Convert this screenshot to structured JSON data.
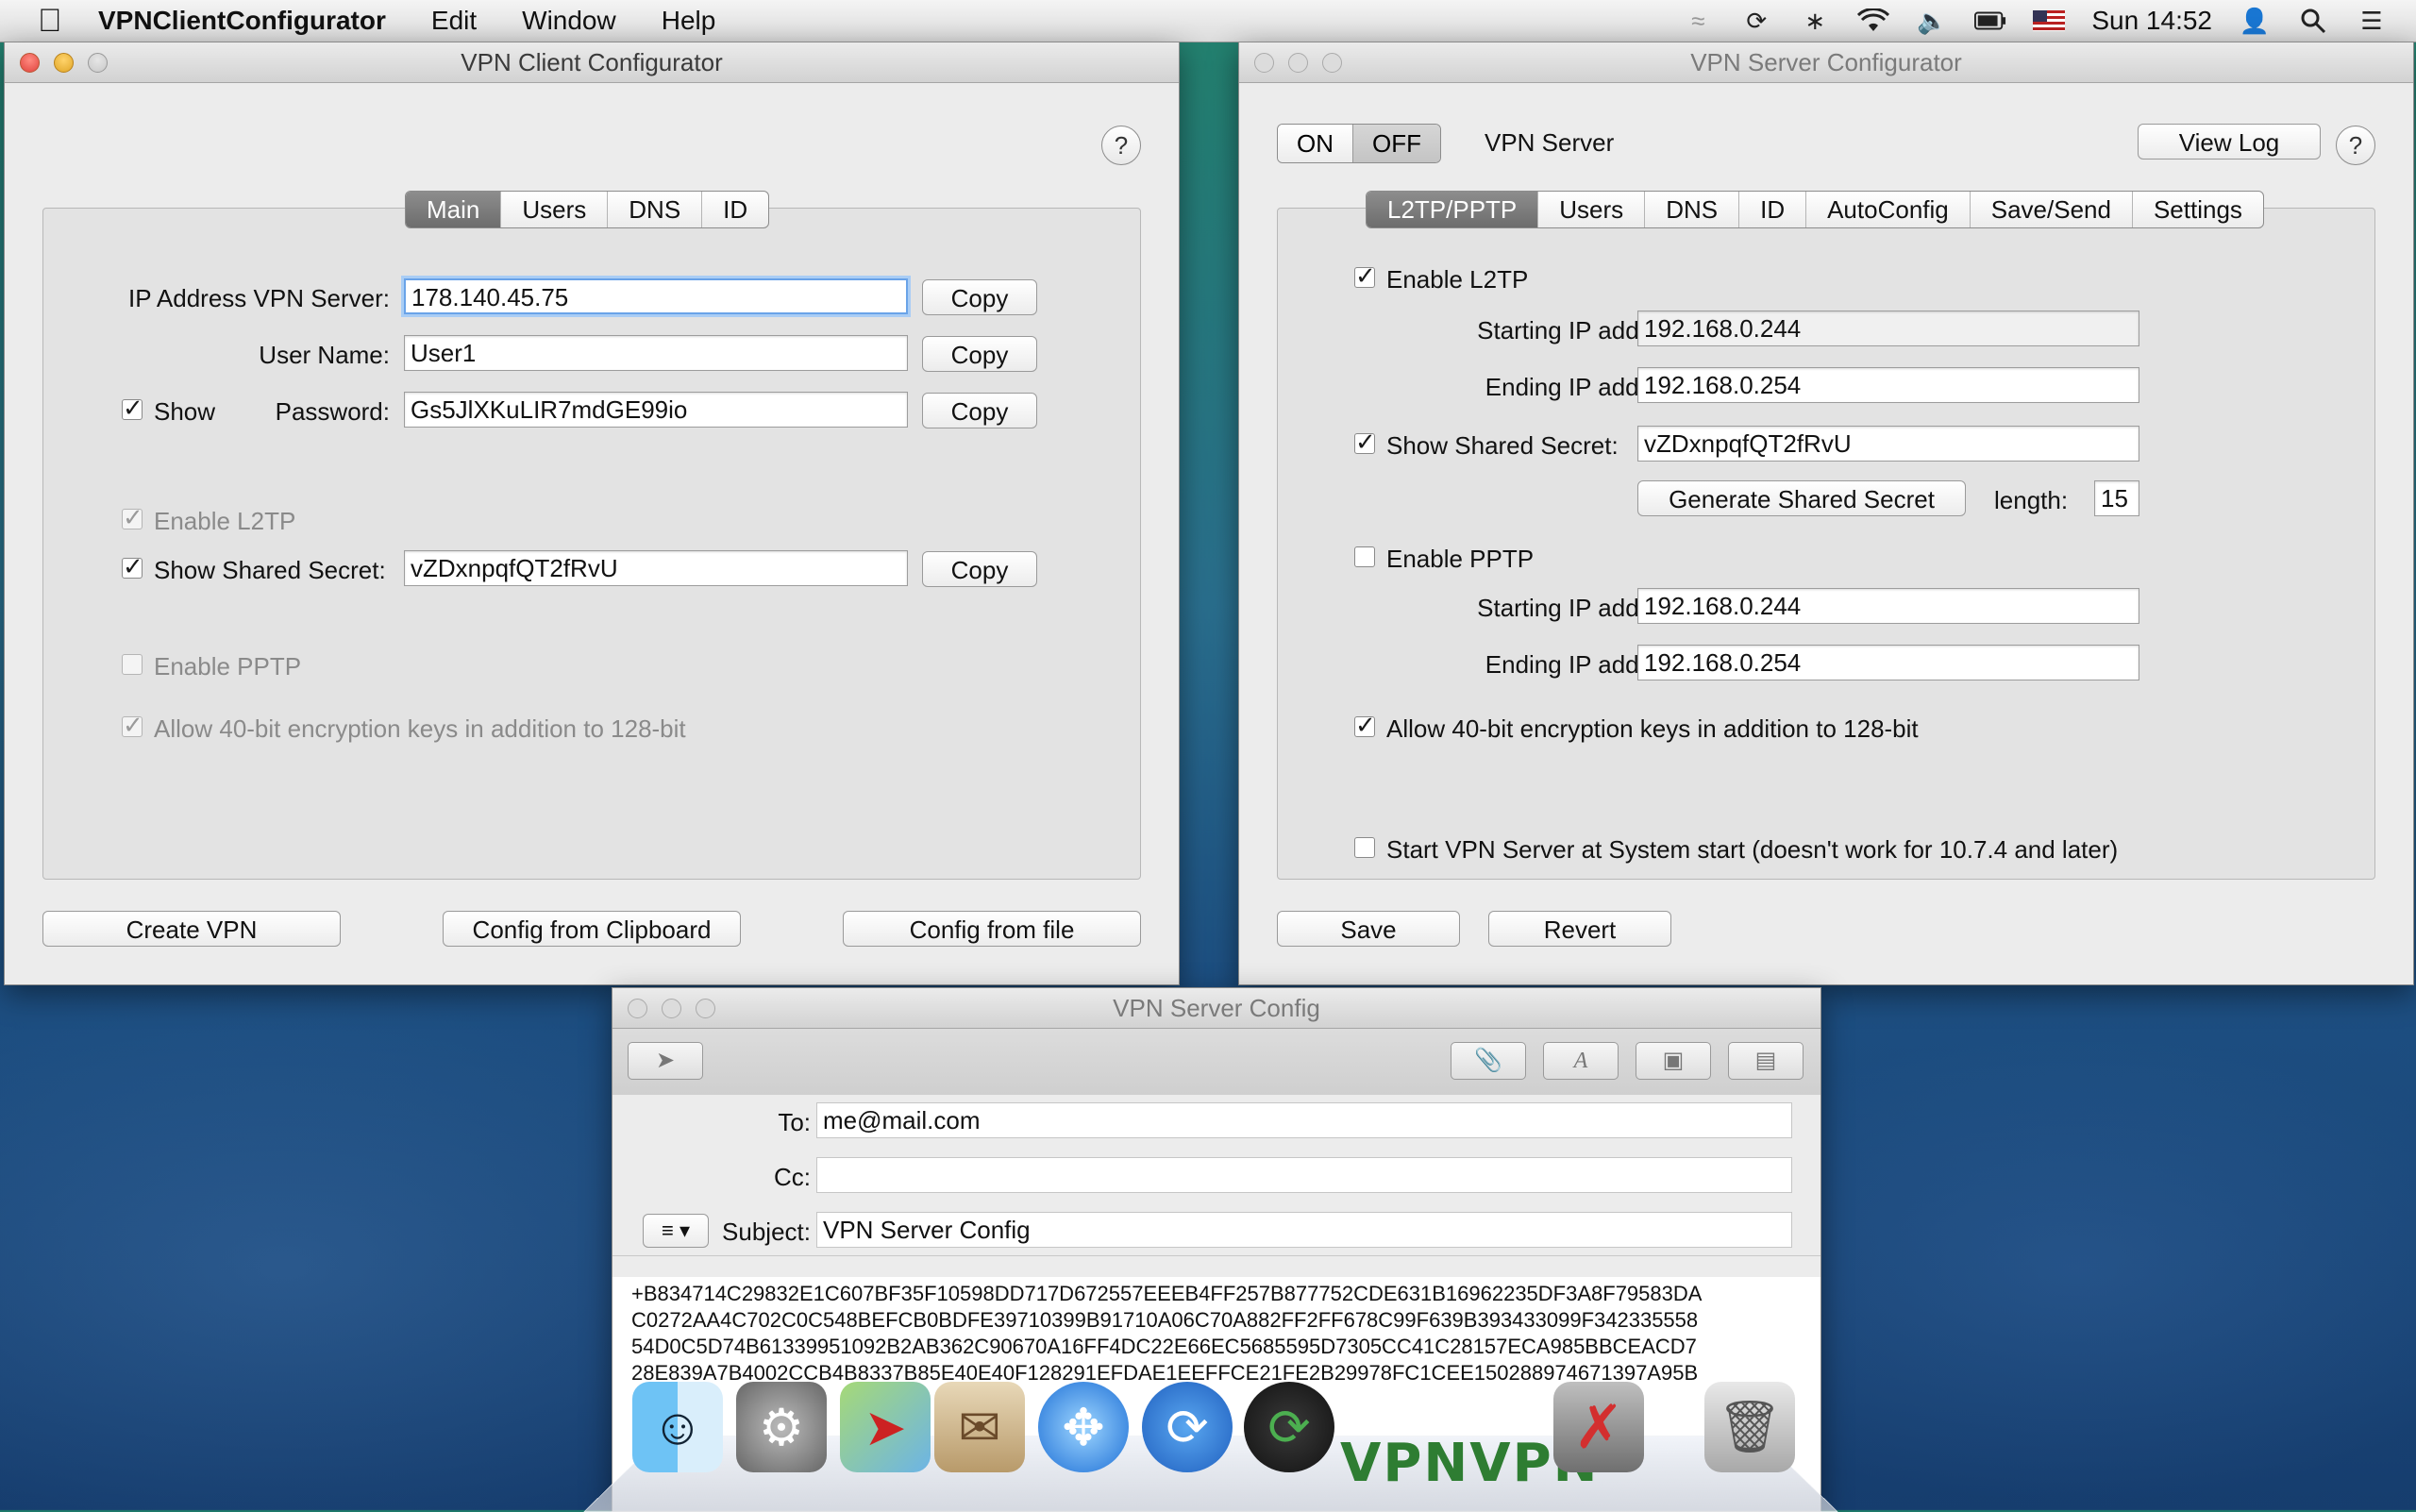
{
  "menubar": {
    "app_name": "VPNClientConfigurator",
    "items": [
      "Edit",
      "Window",
      "Help"
    ],
    "clock": "Sun 14:52"
  },
  "client_window": {
    "title": "VPN Client Configurator",
    "help": "?",
    "tabs": [
      "Main",
      "Users",
      "DNS",
      "ID"
    ],
    "selected_tab": "Main",
    "ip_label": "IP Address VPN Server:",
    "ip_value": "178.140.45.75",
    "user_label": "User Name:",
    "user_value": "User1",
    "show_label": "Show",
    "password_label": "Password:",
    "password_value": "Gs5JlXKuLIR7mdGE99io",
    "copy_label": "Copy",
    "enable_l2tp_label": "Enable L2TP",
    "show_secret_label": "Show Shared Secret:",
    "secret_value": "vZDxnpqfQT2fRvU",
    "enable_pptp_label": "Enable PPTP",
    "allow40_label": "Allow 40-bit encryption keys in addition to 128-bit",
    "create_vpn": "Create VPN",
    "config_clipboard": "Config from Clipboard",
    "config_file": "Config from file"
  },
  "server_window": {
    "title": "VPN Server Configurator",
    "on_label": "ON",
    "off_label": "OFF",
    "vpn_server_label": "VPN Server",
    "view_log": "View Log",
    "help": "?",
    "tabs": [
      "L2TP/PPTP",
      "Users",
      "DNS",
      "ID",
      "AutoConfig",
      "Save/Send",
      "Settings"
    ],
    "selected_tab": "L2TP/PPTP",
    "enable_l2tp_label": "Enable L2TP",
    "starting_ip_label": "Starting IP address:",
    "ending_ip_label": "Ending IP address:",
    "l2tp_start": "192.168.0.244",
    "l2tp_end": "192.168.0.254",
    "show_secret_label": "Show Shared Secret:",
    "secret_value": "vZDxnpqfQT2fRvU",
    "generate_secret": "Generate Shared Secret",
    "length_label": "length:",
    "length_value": "15",
    "enable_pptp_label": "Enable PPTP",
    "pptp_start": "192.168.0.244",
    "pptp_end": "192.168.0.254",
    "allow40_label": "Allow 40-bit encryption keys in addition to 128-bit",
    "start_at_boot_label": "Start VPN Server at System start (doesn't work for 10.7.4 and later)",
    "save": "Save",
    "revert": "Revert"
  },
  "mail_window": {
    "title": "VPN Server Config",
    "to_label": "To:",
    "to_value": "me@mail.com",
    "cc_label": "Cc:",
    "cc_value": "",
    "subject_label": "Subject:",
    "subject_value": "VPN Server Config",
    "body_lines": [
      "+B834714C29832E1C607BF35F10598DD717D672557EEEB4FF257B877752CDE631B16962235DF3A8F79583DA",
      "C0272AA4C702C0C548BEFCB0BDFE39710399B91710A06C70A882FF2FF678C99F639B393433099F342335558",
      "54D0C5D74B61339951092B2AB362C90670A16FF4DC22E66EC5685595D7305CC41C28157ECA985BBCEACD7",
      "28E839A7B4002CCB4B8337B85E40E40F128291EFDAE1EEFFCE21FE2B29978FC1CEE150288974671397A95B"
    ]
  },
  "dock": {
    "items": [
      "finder",
      "system-preferences",
      "maps",
      "mail",
      "safari",
      "sync",
      "vpn-sync",
      "vpn-a",
      "vpn-b",
      "remove",
      "trash"
    ],
    "vpn_text": "VPNVPN"
  }
}
